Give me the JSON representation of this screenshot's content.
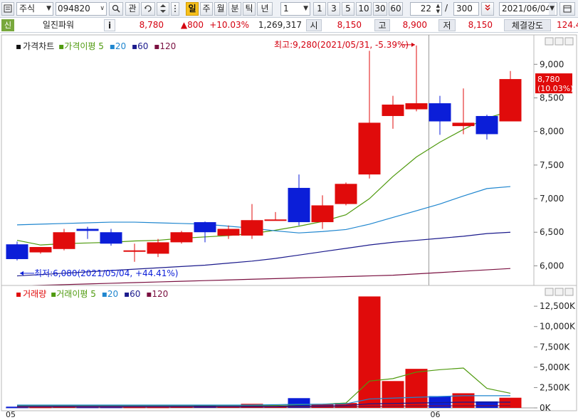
{
  "toolbar": {
    "market_select": "주식",
    "code_input": "094820",
    "search_btn": "⌕",
    "interest_btn": "관",
    "period_active": "일",
    "period_week": "주",
    "period_month": "월",
    "period_minute": "분",
    "period_tick": "틱",
    "period_year": "년",
    "interval_select": "1",
    "interval_1": "1",
    "interval_3": "3",
    "interval_5": "5",
    "interval_10": "10",
    "interval_30": "30",
    "interval_60": "60",
    "count_input": "22",
    "slash": "/",
    "total_input": "300",
    "date_input": "2021/06/04"
  },
  "infobar": {
    "credit_badge": "신",
    "stock_name": "일진파워",
    "info_btn": "i",
    "price": "8,780",
    "change": "▲800",
    "change_rate": "+10.03%",
    "volume": "1,269,317",
    "open_label": "시",
    "open_value": "8,150",
    "high_label": "고",
    "high_value": "8,900",
    "low_label": "저",
    "low_value": "8,150",
    "strength_label": "체결강도",
    "strength_value": "124.4"
  },
  "colors": {
    "up": "#e00b0b",
    "down": "#0b1ed8",
    "ma5": "#4f9a0e",
    "ma20": "#1f86cf",
    "ma60": "#1b1a8c",
    "ma120": "#7a1040"
  },
  "chart_data": [
    {
      "type": "candlestick",
      "title": "가격차트",
      "legend": [
        {
          "name": "가격이평 5",
          "color": "#4f9a0e"
        },
        {
          "name": "20",
          "color": "#1f86cf"
        },
        {
          "name": "60",
          "color": "#1b1a8c"
        },
        {
          "name": "120",
          "color": "#7a1040"
        }
      ],
      "ylim": [
        5750,
        9300
      ],
      "y_ticks": [
        {
          "v": 6000,
          "label": "6,000"
        },
        {
          "v": 6500,
          "label": "6,500"
        },
        {
          "v": 7000,
          "label": "7,000"
        },
        {
          "v": 7500,
          "label": "7,500"
        },
        {
          "v": 8000,
          "label": "8,000"
        },
        {
          "v": 8500,
          "label": "8,500"
        },
        {
          "v": 9000,
          "label": "9,000"
        }
      ],
      "x_ticks": [
        {
          "index": 0,
          "label": "05"
        },
        {
          "index": 18,
          "label": "06"
        }
      ],
      "ohlc": [
        {
          "o": 6320,
          "h": 6360,
          "l": 6080,
          "c": 6100
        },
        {
          "o": 6200,
          "h": 6280,
          "l": 6180,
          "c": 6280
        },
        {
          "o": 6250,
          "h": 6550,
          "l": 6230,
          "c": 6500
        },
        {
          "o": 6550,
          "h": 6580,
          "l": 6400,
          "c": 6520
        },
        {
          "o": 6500,
          "h": 6550,
          "l": 6300,
          "c": 6330
        },
        {
          "o": 6230,
          "h": 6330,
          "l": 6060,
          "c": 6230
        },
        {
          "o": 6180,
          "h": 6400,
          "l": 6130,
          "c": 6350
        },
        {
          "o": 6350,
          "h": 6520,
          "l": 6330,
          "c": 6500
        },
        {
          "o": 6650,
          "h": 6660,
          "l": 6350,
          "c": 6500
        },
        {
          "o": 6450,
          "h": 6600,
          "l": 6400,
          "c": 6550
        },
        {
          "o": 6450,
          "h": 6920,
          "l": 6400,
          "c": 6680
        },
        {
          "o": 6690,
          "h": 6800,
          "l": 6680,
          "c": 6690
        },
        {
          "o": 7160,
          "h": 7360,
          "l": 6600,
          "c": 6650
        },
        {
          "o": 6650,
          "h": 7050,
          "l": 6550,
          "c": 6900
        },
        {
          "o": 6920,
          "h": 7240,
          "l": 6900,
          "c": 7220
        },
        {
          "o": 7360,
          "h": 9200,
          "l": 7300,
          "c": 8130
        },
        {
          "o": 8230,
          "h": 8530,
          "l": 8040,
          "c": 8400
        },
        {
          "o": 8330,
          "h": 9280,
          "l": 8300,
          "c": 8420
        },
        {
          "o": 8420,
          "h": 8530,
          "l": 7950,
          "c": 8150
        },
        {
          "o": 8080,
          "h": 8640,
          "l": 7960,
          "c": 8130
        },
        {
          "o": 8230,
          "h": 8250,
          "l": 7880,
          "c": 7960
        },
        {
          "o": 8150,
          "h": 8900,
          "l": 8150,
          "c": 8780
        }
      ],
      "ma": {
        "ma5": [
          6380,
          6310,
          6330,
          6340,
          6350,
          6370,
          6380,
          6410,
          6430,
          6450,
          6480,
          6530,
          6590,
          6660,
          6760,
          7000,
          7330,
          7620,
          7840,
          8030,
          8200,
          8300
        ],
        "ma20": [
          6610,
          6620,
          6630,
          6640,
          6650,
          6650,
          6640,
          6630,
          6620,
          6590,
          6560,
          6520,
          6490,
          6510,
          6540,
          6620,
          6720,
          6820,
          6920,
          7040,
          7150,
          7180
        ],
        "ma60": [
          5850,
          5870,
          5890,
          5910,
          5930,
          5950,
          5970,
          5990,
          6010,
          6040,
          6070,
          6110,
          6160,
          6210,
          6260,
          6310,
          6350,
          6380,
          6410,
          6440,
          6480,
          6500
        ],
        "ma120": [
          5700,
          5710,
          5720,
          5730,
          5740,
          5750,
          5760,
          5770,
          5780,
          5790,
          5800,
          5810,
          5820,
          5830,
          5840,
          5850,
          5860,
          5880,
          5900,
          5920,
          5940,
          5960
        ]
      },
      "annotations": {
        "high": {
          "text": "최고:9,280(2021/05/31, -5.39%)",
          "index": 17,
          "value": 9280
        },
        "low": {
          "text": "최저:6,080(2021/05/04, +44.41%)",
          "index": 0,
          "value": 6080
        }
      },
      "current_price_label": "8,780",
      "current_rate_label": "(10.03%)"
    },
    {
      "type": "bar",
      "title": "거래량",
      "legend": [
        {
          "name": "거래이평 5",
          "color": "#4f9a0e"
        },
        {
          "name": "20",
          "color": "#1f86cf"
        },
        {
          "name": "60",
          "color": "#1b1a8c"
        },
        {
          "name": "120",
          "color": "#7a1040"
        }
      ],
      "ylim": [
        0,
        14000
      ],
      "y_ticks": [
        {
          "v": 0,
          "label": "0K"
        },
        {
          "v": 2500,
          "label": "2,500K"
        },
        {
          "v": 5000,
          "label": "5,000K"
        },
        {
          "v": 7500,
          "label": "7,500K"
        },
        {
          "v": 10000,
          "label": "10,000K"
        },
        {
          "v": 12500,
          "label": "12,500K"
        }
      ],
      "volume_k": [
        150,
        150,
        200,
        150,
        150,
        150,
        150,
        200,
        280,
        200,
        500,
        200,
        1200,
        450,
        600,
        13700,
        3300,
        4800,
        1450,
        1800,
        800,
        1250
      ],
      "vma5": [
        300,
        300,
        300,
        300,
        300,
        300,
        300,
        300,
        300,
        300,
        300,
        300,
        400,
        450,
        600,
        3300,
        3600,
        4400,
        4700,
        4900,
        2400,
        1800
      ],
      "vma20": [
        350,
        350,
        350,
        350,
        350,
        350,
        350,
        350,
        350,
        350,
        350,
        400,
        450,
        450,
        500,
        1100,
        1200,
        1300,
        1400,
        1500,
        1500,
        1500
      ],
      "vma60": [
        200,
        200,
        200,
        200,
        200,
        200,
        200,
        200,
        200,
        200,
        200,
        200,
        250,
        250,
        300,
        500,
        550,
        600,
        650,
        700,
        700,
        700
      ],
      "vma120": [
        100,
        100,
        100,
        100,
        100,
        100,
        100,
        100,
        100,
        100,
        100,
        100,
        120,
        120,
        130,
        200,
        220,
        240,
        250,
        260,
        270,
        280
      ]
    }
  ]
}
